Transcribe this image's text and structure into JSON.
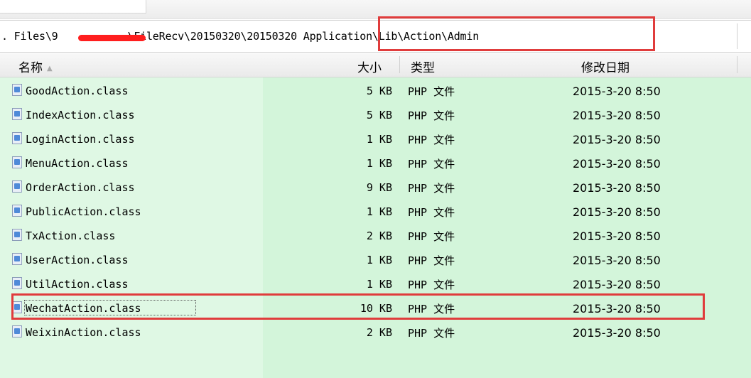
{
  "address": {
    "path_visible_prefix": ". Files\\9",
    "path_visible_suffix": "\\FileRecv\\20150320\\20150320",
    "path_highlighted": "Application\\Lib\\Action\\Admin"
  },
  "columns": {
    "name": "名称",
    "size": "大小",
    "type": "类型",
    "date": "修改日期"
  },
  "files": [
    {
      "name": "GoodAction.class",
      "size": "5 KB",
      "type": "PHP 文件",
      "date": "2015-3-20 8:50"
    },
    {
      "name": "IndexAction.class",
      "size": "5 KB",
      "type": "PHP 文件",
      "date": "2015-3-20 8:50"
    },
    {
      "name": "LoginAction.class",
      "size": "1 KB",
      "type": "PHP 文件",
      "date": "2015-3-20 8:50"
    },
    {
      "name": "MenuAction.class",
      "size": "1 KB",
      "type": "PHP 文件",
      "date": "2015-3-20 8:50"
    },
    {
      "name": "OrderAction.class",
      "size": "9 KB",
      "type": "PHP 文件",
      "date": "2015-3-20 8:50"
    },
    {
      "name": "PublicAction.class",
      "size": "1 KB",
      "type": "PHP 文件",
      "date": "2015-3-20 8:50"
    },
    {
      "name": "TxAction.class",
      "size": "2 KB",
      "type": "PHP 文件",
      "date": "2015-3-20 8:50"
    },
    {
      "name": "UserAction.class",
      "size": "1 KB",
      "type": "PHP 文件",
      "date": "2015-3-20 8:50"
    },
    {
      "name": "UtilAction.class",
      "size": "1 KB",
      "type": "PHP 文件",
      "date": "2015-3-20 8:50"
    },
    {
      "name": "WechatAction.class",
      "size": "10 KB",
      "type": "PHP 文件",
      "date": "2015-3-20 8:50"
    },
    {
      "name": "WeixinAction.class",
      "size": "2 KB",
      "type": "PHP 文件",
      "date": "2015-3-20 8:50"
    }
  ],
  "colors": {
    "highlight_red": "#e03c3c",
    "redaction_red": "#ff1e1e",
    "list_green": "#d3f5da"
  }
}
